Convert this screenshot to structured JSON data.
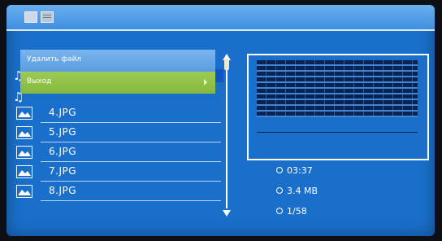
{
  "topbar": {
    "icons": [
      "photo-icon",
      "menu-icon"
    ]
  },
  "menu": {
    "delete_label": "Удалить файл",
    "exit_label": "Выход"
  },
  "files": [
    {
      "name": "",
      "icon": "music-note-icon"
    },
    {
      "name": "",
      "icon": "music-note-icon"
    },
    {
      "name": "4.JPG",
      "icon": "image-icon"
    },
    {
      "name": "5.JPG",
      "icon": "image-icon"
    },
    {
      "name": "6.JPG",
      "icon": "image-icon"
    },
    {
      "name": "7.JPG",
      "icon": "image-icon"
    },
    {
      "name": "8.JPG",
      "icon": "image-icon"
    }
  ],
  "info": {
    "duration": "03:37",
    "size": "3.4 MB",
    "position": "1/58"
  },
  "colors": {
    "background": "#1a6fcb",
    "menu_highlight": "#8ec045",
    "menu_item": "#6aaae8"
  }
}
